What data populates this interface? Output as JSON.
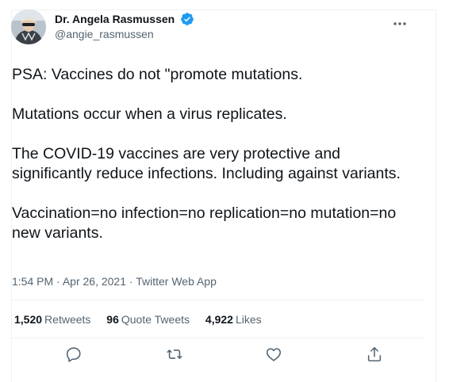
{
  "tweet": {
    "author": {
      "display_name": "Dr. Angela Rasmussen",
      "handle": "@angie_rasmussen",
      "verified": true
    },
    "text": "PSA: Vaccines do not \"promote mutations.\n\nMutations occur when a virus replicates.\n\nThe COVID-19 vaccines are very protective and significantly reduce infections. Including against variants.\n\nVaccination=no infection=no replication=no mutation=no new variants.",
    "time": "1:54 PM",
    "date": "Apr 26, 2021",
    "source": "Twitter Web App",
    "separator": "·"
  },
  "stats": {
    "retweets_count": "1,520",
    "retweets_label": "Retweets",
    "quotes_count": "96",
    "quotes_label": "Quote Tweets",
    "likes_count": "4,922",
    "likes_label": "Likes"
  },
  "icons": {
    "more": "more-icon",
    "verified": "verified-badge-icon",
    "reply": "reply-icon",
    "retweet": "retweet-icon",
    "like": "like-icon",
    "share": "share-icon"
  },
  "colors": {
    "text": "#0f1419",
    "secondary": "#536471",
    "verified": "#1d9bf0",
    "divider": "#eff3f4"
  }
}
